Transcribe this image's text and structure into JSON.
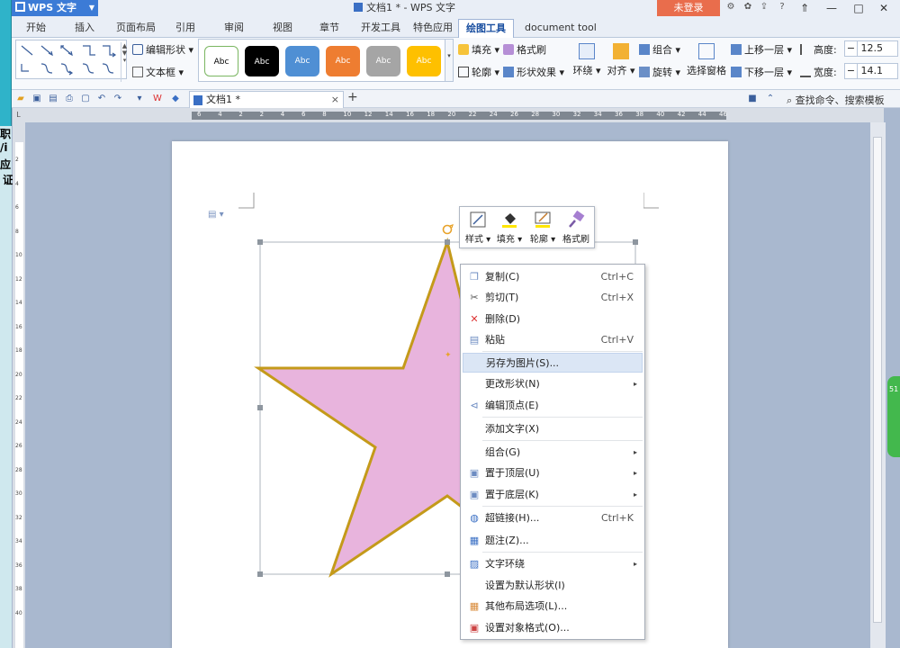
{
  "title_bar": {
    "app_name": "WPS 文字",
    "document_title": "文档1 * - WPS 文字",
    "login_label": "未登录"
  },
  "ribbon_tabs": [
    "开始",
    "插入",
    "页面布局",
    "引用",
    "审阅",
    "视图",
    "章节",
    "开发工具",
    "特色应用",
    "绘图工具",
    "document tool"
  ],
  "active_tab": "绘图工具",
  "ribbon": {
    "edit_shape": "编辑形状",
    "text_box": "文本框",
    "style_swatches": [
      {
        "label": "Abc",
        "bg": "#ffffff",
        "fg": "#000000",
        "border": "#7bb661"
      },
      {
        "label": "Abc",
        "bg": "#000000",
        "fg": "#ffffff",
        "border": "#000000"
      },
      {
        "label": "Abc",
        "bg": "#4f8fd4",
        "fg": "#ffffff",
        "border": "#4f8fd4"
      },
      {
        "label": "Abc",
        "bg": "#ee7d31",
        "fg": "#ffffff",
        "border": "#ee7d31"
      },
      {
        "label": "Abc",
        "bg": "#a5a5a5",
        "fg": "#ffffff",
        "border": "#a5a5a5"
      },
      {
        "label": "Abc",
        "bg": "#fec000",
        "fg": "#ffffff",
        "border": "#fec000"
      }
    ],
    "fill": "填充",
    "format_painter": "格式刷",
    "outline": "轮廓",
    "shape_effects": "形状效果",
    "wrap": "环绕",
    "align": "对齐",
    "group": "组合",
    "rotate": "旋转",
    "selection_pane": "选择窗格",
    "bring_forward": "上移一层",
    "send_backward": "下移一层",
    "height_label": "高度:",
    "height_value": "12.5",
    "width_label": "宽度:",
    "width_value": "14.1"
  },
  "quickbar": {
    "doc_tab": "文档1 *",
    "new_tab": "+",
    "search": "查找命令、搜索模板"
  },
  "ruler": {
    "horizontal_ticks": [
      "6",
      "4",
      "2",
      "2",
      "4",
      "6",
      "8",
      "10",
      "12",
      "14",
      "16",
      "18",
      "20",
      "22",
      "24",
      "26",
      "28",
      "30",
      "32",
      "34",
      "36",
      "38",
      "40",
      "42",
      "44",
      "46"
    ],
    "vertical_ticks": [
      "2",
      "4",
      "6",
      "8",
      "10",
      "12",
      "14",
      "16",
      "18",
      "20",
      "22",
      "24",
      "26",
      "28",
      "30",
      "32",
      "34",
      "36",
      "38",
      "40"
    ]
  },
  "left_strip_chars": [
    "职",
    "/i",
    "应",
    "证"
  ],
  "right_widget_text": "51",
  "mini_toolbar": [
    {
      "label": "样式",
      "icon": "style-icon"
    },
    {
      "label": "填充",
      "icon": "fill-bucket-icon"
    },
    {
      "label": "轮廓",
      "icon": "outline-pen-icon"
    },
    {
      "label": "格式刷",
      "icon": "format-brush-icon"
    }
  ],
  "context_menu": [
    {
      "label": "复制(C)",
      "shortcut": "Ctrl+C",
      "icon": "copy-icon",
      "submenu": false
    },
    {
      "label": "剪切(T)",
      "shortcut": "Ctrl+X",
      "icon": "cut-icon",
      "submenu": false
    },
    {
      "label": "删除(D)",
      "shortcut": "",
      "icon": "delete-icon",
      "submenu": false
    },
    {
      "label": "粘贴",
      "shortcut": "Ctrl+V",
      "icon": "paste-icon",
      "submenu": false
    },
    {
      "label": "另存为图片(S)...",
      "shortcut": "",
      "icon": "",
      "submenu": false
    },
    {
      "label": "更改形状(N)",
      "shortcut": "",
      "icon": "",
      "submenu": true
    },
    {
      "label": "编辑顶点(E)",
      "shortcut": "",
      "icon": "edit-points-icon",
      "submenu": false
    },
    {
      "label": "添加文字(X)",
      "shortcut": "",
      "icon": "",
      "submenu": false
    },
    {
      "label": "组合(G)",
      "shortcut": "",
      "icon": "",
      "submenu": true
    },
    {
      "label": "置于顶层(U)",
      "shortcut": "",
      "icon": "bring-to-front-icon",
      "submenu": true
    },
    {
      "label": "置于底层(K)",
      "shortcut": "",
      "icon": "send-to-back-icon",
      "submenu": true
    },
    {
      "label": "超链接(H)...",
      "shortcut": "Ctrl+K",
      "icon": "hyperlink-icon",
      "submenu": false
    },
    {
      "label": "题注(Z)...",
      "shortcut": "",
      "icon": "caption-icon",
      "submenu": false
    },
    {
      "label": "文字环绕",
      "shortcut": "",
      "icon": "text-wrap-icon",
      "submenu": true
    },
    {
      "label": "设置为默认形状(I)",
      "shortcut": "",
      "icon": "",
      "submenu": false
    },
    {
      "label": "其他布局选项(L)...",
      "shortcut": "",
      "icon": "layout-options-icon",
      "submenu": false
    },
    {
      "label": "设置对象格式(O)...",
      "shortcut": "",
      "icon": "format-object-icon",
      "submenu": false
    }
  ],
  "shape": {
    "type": "star",
    "fill_color": "#e8b4dd",
    "outline_color": "#c49a1a"
  },
  "colors": {
    "accent": "#3c7bd6",
    "login": "#e96d4c",
    "menu_hover": "#dbe6f5"
  }
}
